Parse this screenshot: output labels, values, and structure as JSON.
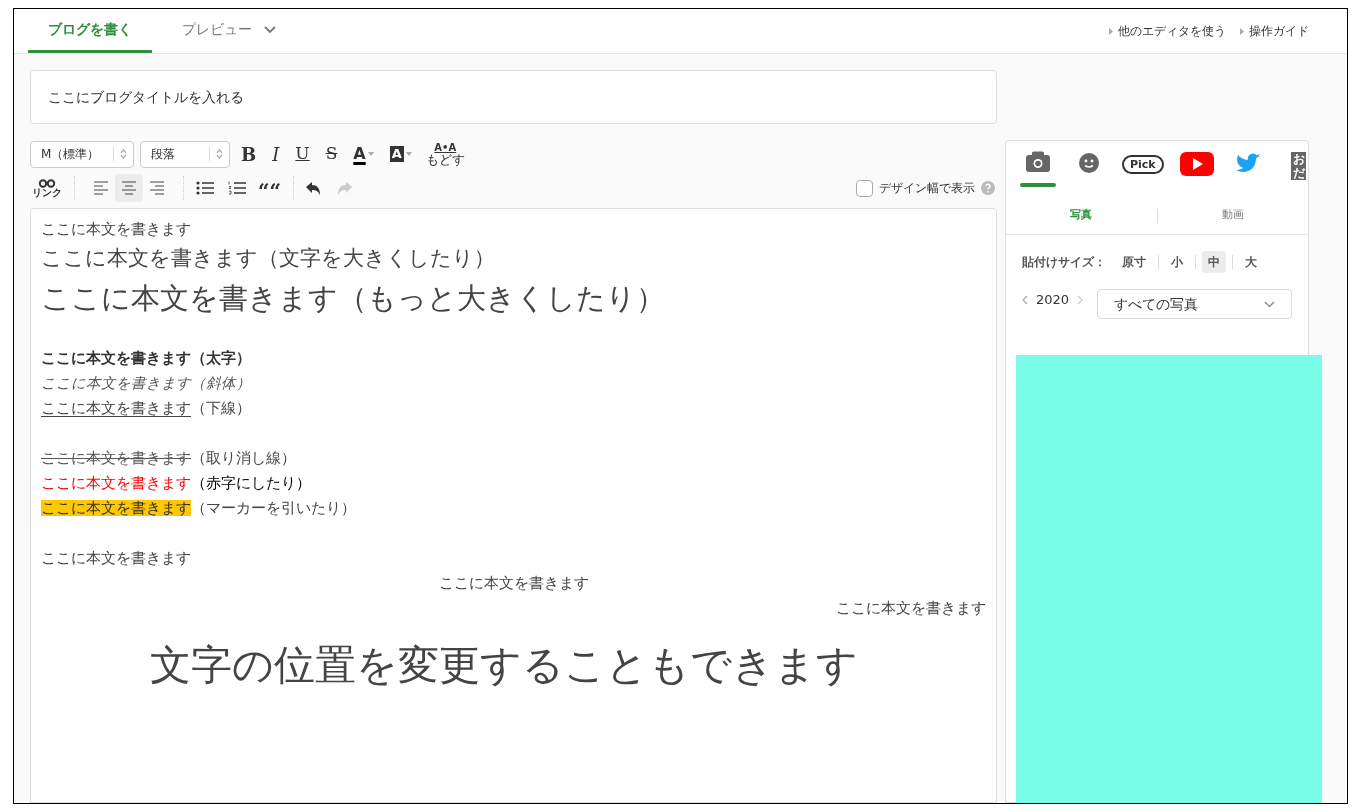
{
  "tabs": [
    {
      "label": "ブログを書く",
      "selected": true,
      "dropdown": false
    },
    {
      "label": "プレビュー",
      "selected": false,
      "dropdown": true
    }
  ],
  "top_links": [
    "他のエディタを使う",
    "操作ガイド"
  ],
  "title_field": {
    "value": "ここにブログタイトルを入れる"
  },
  "toolbar": {
    "font_size": "M（標準）",
    "block_format": "段落",
    "format_buttons": [
      {
        "label": "B",
        "kind": "bold"
      },
      {
        "label": "I",
        "kind": "italic"
      },
      {
        "label": "U",
        "kind": "underline"
      },
      {
        "label": "S",
        "kind": "strike"
      },
      {
        "label": "A",
        "kind": "text-color"
      },
      {
        "label": "A",
        "kind": "highlight"
      }
    ],
    "reset": {
      "top": "A•A",
      "bottom": "もどす"
    },
    "link_label": "リンク",
    "align_buttons": [
      {
        "kind": "left",
        "selected": false
      },
      {
        "kind": "center",
        "selected": true
      },
      {
        "kind": "right",
        "selected": false
      }
    ],
    "quote": "““",
    "undo": {
      "disabled": false
    },
    "redo": {
      "disabled": true
    },
    "design_width": {
      "label": "デザイン幅で表示",
      "checked": false
    }
  },
  "editor_lines": [
    {
      "kind": "body",
      "gap_before": false,
      "segments": [
        {
          "text": "ここに本文を書きます",
          "kind": "plain"
        }
      ]
    },
    {
      "kind": "large",
      "gap_before": false,
      "segments": [
        {
          "text": "ここに本文を書きます（文字を大きくしたり）",
          "kind": "plain"
        }
      ]
    },
    {
      "kind": "xlarge",
      "gap_before": false,
      "segments": [
        {
          "text": "ここに本文を書きます（もっと大きくしたり）",
          "kind": "plain"
        }
      ]
    },
    {
      "kind": "body",
      "gap_before": true,
      "segments": [
        {
          "text": "ここに本文を書きます（太字）",
          "kind": "bold"
        }
      ]
    },
    {
      "kind": "body",
      "gap_before": false,
      "segments": [
        {
          "text": "ここに本文を書きます（斜体）",
          "kind": "italic"
        }
      ]
    },
    {
      "kind": "body",
      "gap_before": false,
      "segments": [
        {
          "text": "ここに本文を書きます",
          "kind": "underline"
        },
        {
          "text": "（下線）",
          "kind": "plain"
        }
      ]
    },
    {
      "kind": "body",
      "gap_before": true,
      "segments": [
        {
          "text": "ここに本文を書きます",
          "kind": "strike"
        },
        {
          "text": "（取り消し線）",
          "kind": "plain"
        }
      ]
    },
    {
      "kind": "body",
      "gap_before": false,
      "segments": [
        {
          "text": "ここに本文を書きます",
          "kind": "red"
        },
        {
          "text": "（赤字にしたり）",
          "kind": "dark"
        }
      ]
    },
    {
      "kind": "body",
      "gap_before": false,
      "segments": [
        {
          "text": "ここに本文を書きます",
          "kind": "marker"
        },
        {
          "text": "（マーカーを引いたり）",
          "kind": "plain"
        }
      ]
    },
    {
      "kind": "body",
      "gap_before": true,
      "segments": [
        {
          "text": "ここに本文を書きます",
          "kind": "plain"
        }
      ]
    },
    {
      "kind": "centered",
      "gap_before": false,
      "segments": [
        {
          "text": "ここに本文を書きます",
          "kind": "plain"
        }
      ]
    },
    {
      "kind": "right",
      "gap_before": false,
      "segments": [
        {
          "text": "ここに本文を書きます",
          "kind": "plain"
        }
      ]
    },
    {
      "kind": "centered-huge",
      "gap_before": false,
      "segments": [
        {
          "text": "文字の位置を変更することもできます",
          "kind": "plain"
        }
      ]
    }
  ],
  "media_panel": {
    "tabs": [
      {
        "kind": "camera",
        "selected": true
      },
      {
        "kind": "face",
        "selected": false
      },
      {
        "kind": "pick",
        "label": "Pick",
        "selected": false
      },
      {
        "kind": "video",
        "selected": false
      },
      {
        "kind": "bird",
        "selected": false
      },
      {
        "kind": "text",
        "label": "おだ",
        "selected": false
      }
    ],
    "sub_tabs": [
      {
        "label": "写真",
        "selected": true
      },
      {
        "label": "動画",
        "selected": false
      }
    ],
    "size_label": "貼付けサイズ：",
    "sizes": [
      {
        "label": "原寸",
        "selected": false
      },
      {
        "label": "小",
        "selected": false
      },
      {
        "label": "中",
        "selected": true
      },
      {
        "label": "大",
        "selected": false
      }
    ],
    "year": "2020",
    "album": "すべての写真"
  }
}
